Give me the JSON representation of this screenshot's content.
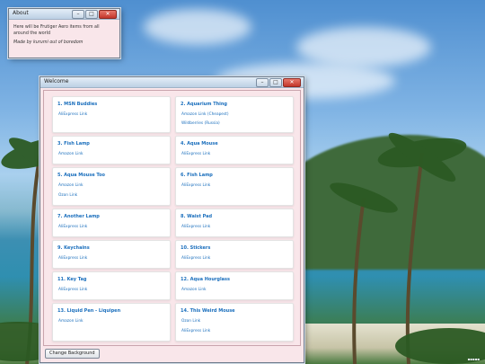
{
  "about": {
    "title": "About",
    "line1": "Here will be Frutiger Aero items from all around the world",
    "line2": "Made by kurumi out of boredom"
  },
  "welcome": {
    "title": "Welcome",
    "cards": [
      {
        "title": "1. MSN Buddies",
        "links": [
          "AliExpress Link"
        ]
      },
      {
        "title": "2. Aquarium Thing",
        "links": [
          "Amazon Link (Cheapest)",
          "Wildberries (Russia)"
        ]
      },
      {
        "title": "3. Fish Lamp",
        "links": [
          "Amazon Link"
        ]
      },
      {
        "title": "4. Aqua Mouse",
        "links": [
          "AliExpress Link"
        ]
      },
      {
        "title": "5. Aqua Mouse Too",
        "links": [
          "Amazon Link",
          "Ozon Link"
        ]
      },
      {
        "title": "6. Fish Lamp",
        "links": [
          "AliExpress Link"
        ]
      },
      {
        "title": "7. Another Lamp",
        "links": [
          "AliExpress Link"
        ]
      },
      {
        "title": "8. Waist Pad",
        "links": [
          "AliExpress Link"
        ]
      },
      {
        "title": "9. Keychains",
        "links": [
          "AliExpress Link"
        ]
      },
      {
        "title": "10. Stickers",
        "links": [
          "AliExpress Link"
        ]
      },
      {
        "title": "11. Key Tag",
        "links": [
          "AliExpress Link"
        ]
      },
      {
        "title": "12. Aqua Hourglass",
        "links": [
          "Amazon Link"
        ]
      },
      {
        "title": "13. Liquid Pen - Liquipen",
        "links": [
          "Amazon Link"
        ]
      },
      {
        "title": "14. This Weird Mouse",
        "links": [
          "Ozon Link",
          "AliExpress Link"
        ]
      }
    ],
    "change_background": "Change Background"
  },
  "window_controls": {
    "minimize": "–",
    "maximize": "□",
    "close": "✕"
  },
  "colors": {
    "link": "#1b6fbd",
    "window_bg": "#f9e6ea"
  }
}
